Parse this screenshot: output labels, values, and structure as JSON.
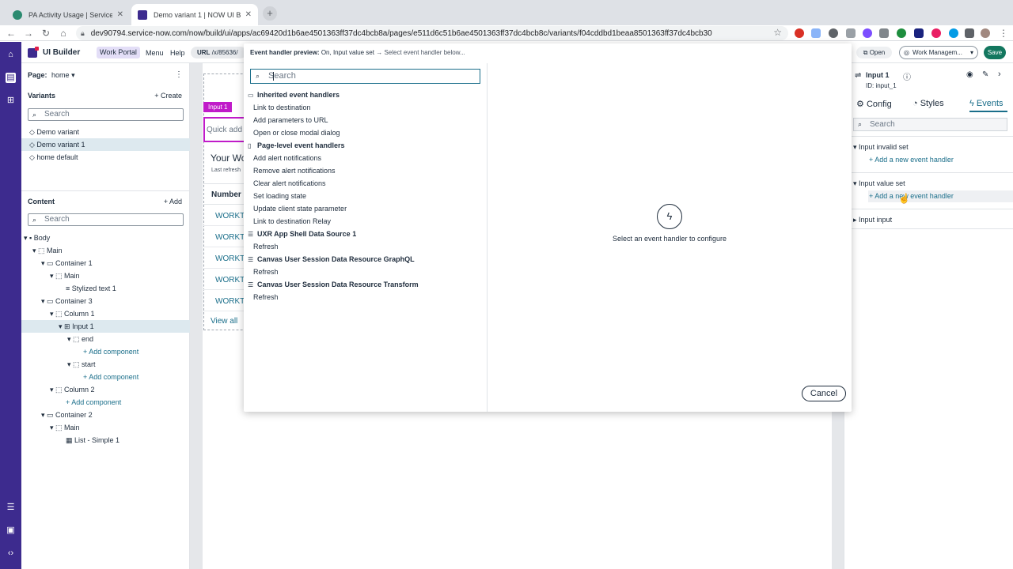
{
  "browser": {
    "tabs": [
      {
        "title": "PA Activity Usage | ServiceN",
        "active": false
      },
      {
        "title": "Demo variant 1 | NOW UI Builder",
        "active": true
      }
    ],
    "url": "dev90794.service-now.com/now/build/ui/apps/ac69420d1b6ae4501363ff37dc4bcb8a/pages/e511d6c51b6ae4501363ff37dc4bcb8c/variants/f04cddbd1beaa8501363ff37dc4bcb30"
  },
  "header": {
    "app_name": "UI Builder",
    "portal": "Work Portal",
    "menu": "Menu",
    "help": "Help",
    "url_label": "URL",
    "url_value": "/x/85636/",
    "open": "Open",
    "workspace": "Work Managem...",
    "save": "Save"
  },
  "left_panel": {
    "page_label": "Page:",
    "page_value": "home",
    "variants_title": "Variants",
    "create": "+ Create",
    "variants_search": "Search",
    "variants": [
      "Demo variant",
      "Demo variant 1",
      "home default"
    ],
    "selected_variant": 1,
    "content_title": "Content",
    "add": "+ Add",
    "content_search": "Search",
    "tree": [
      {
        "label": "Body",
        "indent": 0,
        "twisty": "▾",
        "icon": "▪"
      },
      {
        "label": "Main",
        "indent": 1,
        "twisty": "▾",
        "icon": "⬚"
      },
      {
        "label": "Container 1",
        "indent": 2,
        "twisty": "▾",
        "icon": "▭"
      },
      {
        "label": "Main",
        "indent": 3,
        "twisty": "▾",
        "icon": "⬚"
      },
      {
        "label": "Stylized text 1",
        "indent": 4,
        "twisty": "",
        "icon": "≡"
      },
      {
        "label": "Container 3",
        "indent": 2,
        "twisty": "▾",
        "icon": "▭"
      },
      {
        "label": "Column 1",
        "indent": 3,
        "twisty": "▾",
        "icon": "⬚"
      },
      {
        "label": "Input 1",
        "indent": 4,
        "twisty": "▾",
        "icon": "⊞",
        "selected": true
      },
      {
        "label": "end",
        "indent": 5,
        "twisty": "▾",
        "icon": "⬚"
      },
      {
        "label": "+ Add component",
        "indent": 6,
        "twisty": "",
        "icon": "",
        "add": true
      },
      {
        "label": "start",
        "indent": 5,
        "twisty": "▾",
        "icon": "⬚"
      },
      {
        "label": "+ Add component",
        "indent": 6,
        "twisty": "",
        "icon": "",
        "add": true
      },
      {
        "label": "Column 2",
        "indent": 3,
        "twisty": "▾",
        "icon": "⬚"
      },
      {
        "label": "+ Add component",
        "indent": 4,
        "twisty": "",
        "icon": "",
        "add": true
      },
      {
        "label": "Container 2",
        "indent": 2,
        "twisty": "▾",
        "icon": "▭"
      },
      {
        "label": "Main",
        "indent": 3,
        "twisty": "▾",
        "icon": "⬚"
      },
      {
        "label": "List - Simple 1",
        "indent": 4,
        "twisty": "",
        "icon": "▦"
      }
    ]
  },
  "canvas": {
    "comp_tag": "Input 1",
    "quick_add": "Quick add t",
    "heading": "Your Wo",
    "refreshed": "Last refresh",
    "col_header": "Number",
    "rows": [
      "WORKTA",
      "WORKTA",
      "WORKTA",
      "WORKTA",
      "WORKTA"
    ],
    "view_all": "View all"
  },
  "right_panel": {
    "title": "Input 1",
    "id": "ID: input_1",
    "tabs": [
      "Config",
      "Styles",
      "Events"
    ],
    "search": "Search",
    "events": [
      {
        "label": "Input invalid set",
        "add": "+ Add a new event handler"
      },
      {
        "label": "Input value set",
        "add": "+ Add a new event handler"
      },
      {
        "label": "Input input"
      }
    ]
  },
  "modal": {
    "title_bold": "Event handler preview:",
    "title_mid": "On, Input value set",
    "title_sub": "→ Select event handler below...",
    "search_placeholder": "Search",
    "groups": [
      {
        "label": "Inherited event handlers",
        "icon": "▭",
        "items": [
          "Link to destination",
          "Add parameters to URL",
          "Open or close modal dialog"
        ]
      },
      {
        "label": "Page-level event handlers",
        "icon": "▯",
        "items": [
          "Add alert notifications",
          "Remove alert notifications",
          "Clear alert notifications",
          "Set loading state",
          "Update client state parameter",
          "Link to destination Relay"
        ]
      },
      {
        "label": "UXR App Shell Data Source 1",
        "icon": "☰",
        "items": [
          "Refresh"
        ]
      },
      {
        "label": "Canvas User Session Data Resource GraphQL",
        "icon": "☰",
        "items": [
          "Refresh"
        ]
      },
      {
        "label": "Canvas User Session Data Resource Transform",
        "icon": "☰",
        "items": [
          "Refresh"
        ]
      }
    ],
    "empty_text": "Select an event handler to configure",
    "cancel": "Cancel"
  },
  "colors": {
    "rail": "#3d2b8e",
    "accent": "#1a6e8a",
    "save": "#13775f",
    "component_tag": "#c01bc9"
  }
}
